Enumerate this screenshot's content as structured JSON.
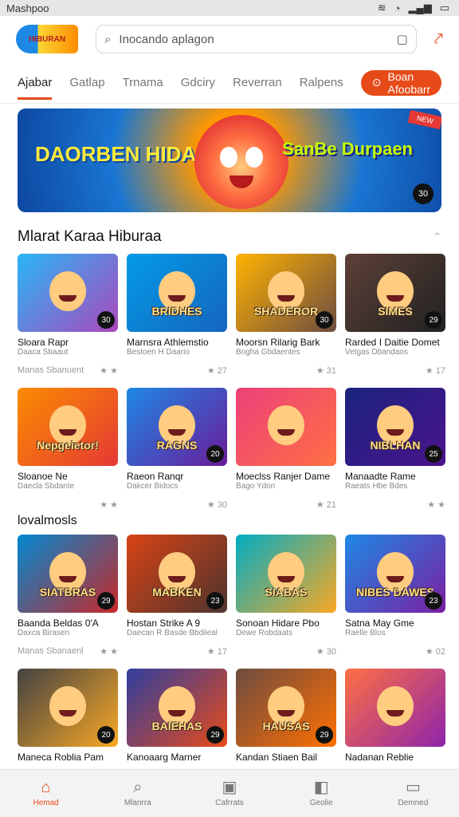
{
  "status": {
    "app": "Mashpoo",
    "icons": [
      "nfc-icon",
      "wifi-icon",
      "signal-icon",
      "battery-icon"
    ]
  },
  "header": {
    "logo_text": "HIBURAN",
    "search_placeholder": "Inocando aplagon"
  },
  "tabs": {
    "items": [
      "Ajabar",
      "Gatlap",
      "Trnama",
      "Gdciry",
      "Reverran",
      "Ralpens"
    ],
    "cta_label": "Boan Afoobarr"
  },
  "banner": {
    "left_text": "DAORBEN HIDAITIES",
    "right_text": "SanBe Durpaen",
    "ribbon": "NEW",
    "badge": "30"
  },
  "section1": {
    "title": "Mlarat Karaa Hiburaa"
  },
  "section2": {
    "title": "lovalmosls"
  },
  "rows": [
    [
      {
        "name": "Sloara Rapr",
        "sub": "Daaca Sbaaut",
        "meta_left": "Manas Sbanuent",
        "meta_right": "★ ★",
        "badge": "30",
        "cap": "",
        "bg": "linear-gradient(135deg,#29b6f6,#ab47bc)"
      },
      {
        "name": "Marnsra Athlemstio",
        "sub": "Bestoen H Daario",
        "meta_left": "",
        "meta_right": "★ 27",
        "badge": "",
        "cap": "BRIDHES",
        "bg": "linear-gradient(135deg,#039be5,#1565c0)"
      },
      {
        "name": "Moorsn Rilarig Bark",
        "sub": "Bogha Gbdaentes",
        "meta_left": "",
        "meta_right": "★ 31",
        "badge": "30",
        "cap": "SHADEROR",
        "bg": "linear-gradient(135deg,#ffb300,#6d4c41)"
      },
      {
        "name": "Rarded I Daitie Domet",
        "sub": "Vetgas Dbandaos",
        "meta_left": "",
        "meta_right": "★ 17",
        "badge": "29",
        "cap": "SIMES",
        "bg": "linear-gradient(135deg,#5d4037,#212121)"
      }
    ],
    [
      {
        "name": "Sloanoe Ne",
        "sub": "Daecla Sbdante",
        "meta_left": "",
        "meta_right": "★ ★",
        "badge": "",
        "cap": "Nepgeietor!",
        "bg": "linear-gradient(135deg,#fb8c00,#e53935)"
      },
      {
        "name": "Raeon Ranqr",
        "sub": "Dakcer Bidocs",
        "meta_left": "",
        "meta_right": "★ 30",
        "badge": "20",
        "cap": "RAGNS",
        "bg": "linear-gradient(135deg,#1e88e5,#6a1b9a)"
      },
      {
        "name": "Moeclss Ranjer Dame",
        "sub": "Bago Ydon",
        "meta_left": "",
        "meta_right": "★ 21",
        "badge": "",
        "cap": "",
        "bg": "linear-gradient(135deg,#ec407a,#ff7043)"
      },
      {
        "name": "Manaadte Rame",
        "sub": "Raeats Hbe Bdes",
        "meta_left": "",
        "meta_right": "★ ★",
        "badge": "25",
        "cap": "NIBLHAN",
        "bg": "linear-gradient(135deg,#1a237e,#4a148c)"
      }
    ],
    [
      {
        "name": "Baanda Beldas 0'A",
        "sub": "Daxca Birasen",
        "meta_left": "Manas Sbanaenl",
        "meta_right": "★ ★",
        "badge": "29",
        "cap": "SIATBRAS",
        "bg": "linear-gradient(135deg,#0288d1,#c62828)"
      },
      {
        "name": "Hostan Strike A 9",
        "sub": "Daecan R Basde Bbdiieal",
        "meta_left": "",
        "meta_right": "★ 17",
        "badge": "23",
        "cap": "MABKEN",
        "bg": "linear-gradient(135deg,#d84315,#4e342e)"
      },
      {
        "name": "Sonoan Hidare Pbo",
        "sub": "Dewe Robdaats",
        "meta_left": "",
        "meta_right": "★ 30",
        "badge": "",
        "cap": "SIABAS",
        "bg": "linear-gradient(135deg,#00acc1,#f9a825)"
      },
      {
        "name": "Satna May Gme",
        "sub": "Raelle Blos",
        "meta_left": "",
        "meta_right": "★ 02",
        "badge": "23",
        "cap": "NIBES DAWES",
        "bg": "linear-gradient(135deg,#1e88e5,#7b1fa2)"
      }
    ],
    [
      {
        "name": "Maneca Roblia Pam",
        "sub": "",
        "meta_left": "",
        "meta_right": "",
        "badge": "20",
        "cap": "",
        "bg": "linear-gradient(135deg,#424242,#f9a825)"
      },
      {
        "name": "Kanoaarg Marner",
        "sub": "",
        "meta_left": "",
        "meta_right": "",
        "badge": "29",
        "cap": "BAIEHAS",
        "bg": "linear-gradient(135deg,#303f9f,#e64a19)"
      },
      {
        "name": "Kandan Stiaen Bail",
        "sub": "",
        "meta_left": "",
        "meta_right": "",
        "badge": "29",
        "cap": "HAUSAS",
        "bg": "linear-gradient(135deg,#6d4c41,#ff6f00)"
      },
      {
        "name": "Nadanan Reblie",
        "sub": "",
        "meta_left": "",
        "meta_right": "",
        "badge": "",
        "cap": "",
        "bg": "linear-gradient(135deg,#ff7043,#8e24aa)"
      }
    ]
  ],
  "bottom_nav": [
    {
      "label": "Hemad",
      "icon": "home-icon"
    },
    {
      "label": "Mlanrra",
      "icon": "search-icon"
    },
    {
      "label": "Cafrrats",
      "icon": "camera-icon"
    },
    {
      "label": "Geolie",
      "icon": "notification-icon"
    },
    {
      "label": "Demned",
      "icon": "inbox-icon"
    }
  ],
  "colors": {
    "accent": "#e64a19"
  }
}
